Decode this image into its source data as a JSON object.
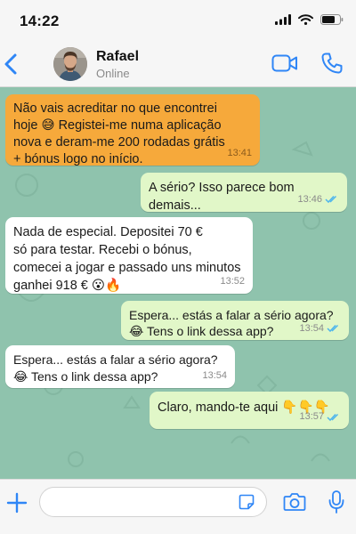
{
  "status_bar": {
    "time": "14:22"
  },
  "header": {
    "contact_name": "Rafael",
    "contact_status": "Online"
  },
  "messages": [
    {
      "direction": "in",
      "style": "highlight",
      "text": "Não vais acreditar no que encontrei\nhoje 😅 Registei-me numa aplicação\nnova e deram-me 200 rodadas grátis\n+ bónus logo no início.",
      "time": "13:41"
    },
    {
      "direction": "out",
      "text": "A sério? Isso parece bom\ndemais...",
      "time": "13:46",
      "read": true
    },
    {
      "direction": "in",
      "text": "Nada de especial. Depositei 70 €\nsó para testar. Recebi o bónus,\ncomecei a jogar e passado uns minutos\nganhei 918 € 😮🔥",
      "time": "13:52"
    },
    {
      "direction": "out",
      "text": "Espera... estás a falar a sério agora?\n😂 Tens o link dessa app?",
      "time": "13:54",
      "read": true
    },
    {
      "direction": "in",
      "text": "Espera... estás a falar a sério agora?\n😂 Tens o link dessa app?",
      "time": "13:54"
    },
    {
      "direction": "out",
      "text": "Claro, mando-te aqui 👇👇👇",
      "time": "13:57",
      "read": true
    }
  ],
  "composer": {
    "placeholder": "",
    "value": ""
  },
  "colors": {
    "accent": "#2f86f6",
    "chat_background": "#8fc3ad",
    "bubble_in": "#ffffff",
    "bubble_out": "#e1f7c8",
    "bubble_highlight": "#f6a93b",
    "read_ticks": "#4fb6ec"
  },
  "icons": {
    "back": "chevron-left-icon",
    "video": "video-camera-icon",
    "call": "phone-icon",
    "plus": "plus-icon",
    "sticker": "sticker-icon",
    "camera": "camera-icon",
    "mic": "microphone-icon",
    "read": "double-check-icon"
  }
}
